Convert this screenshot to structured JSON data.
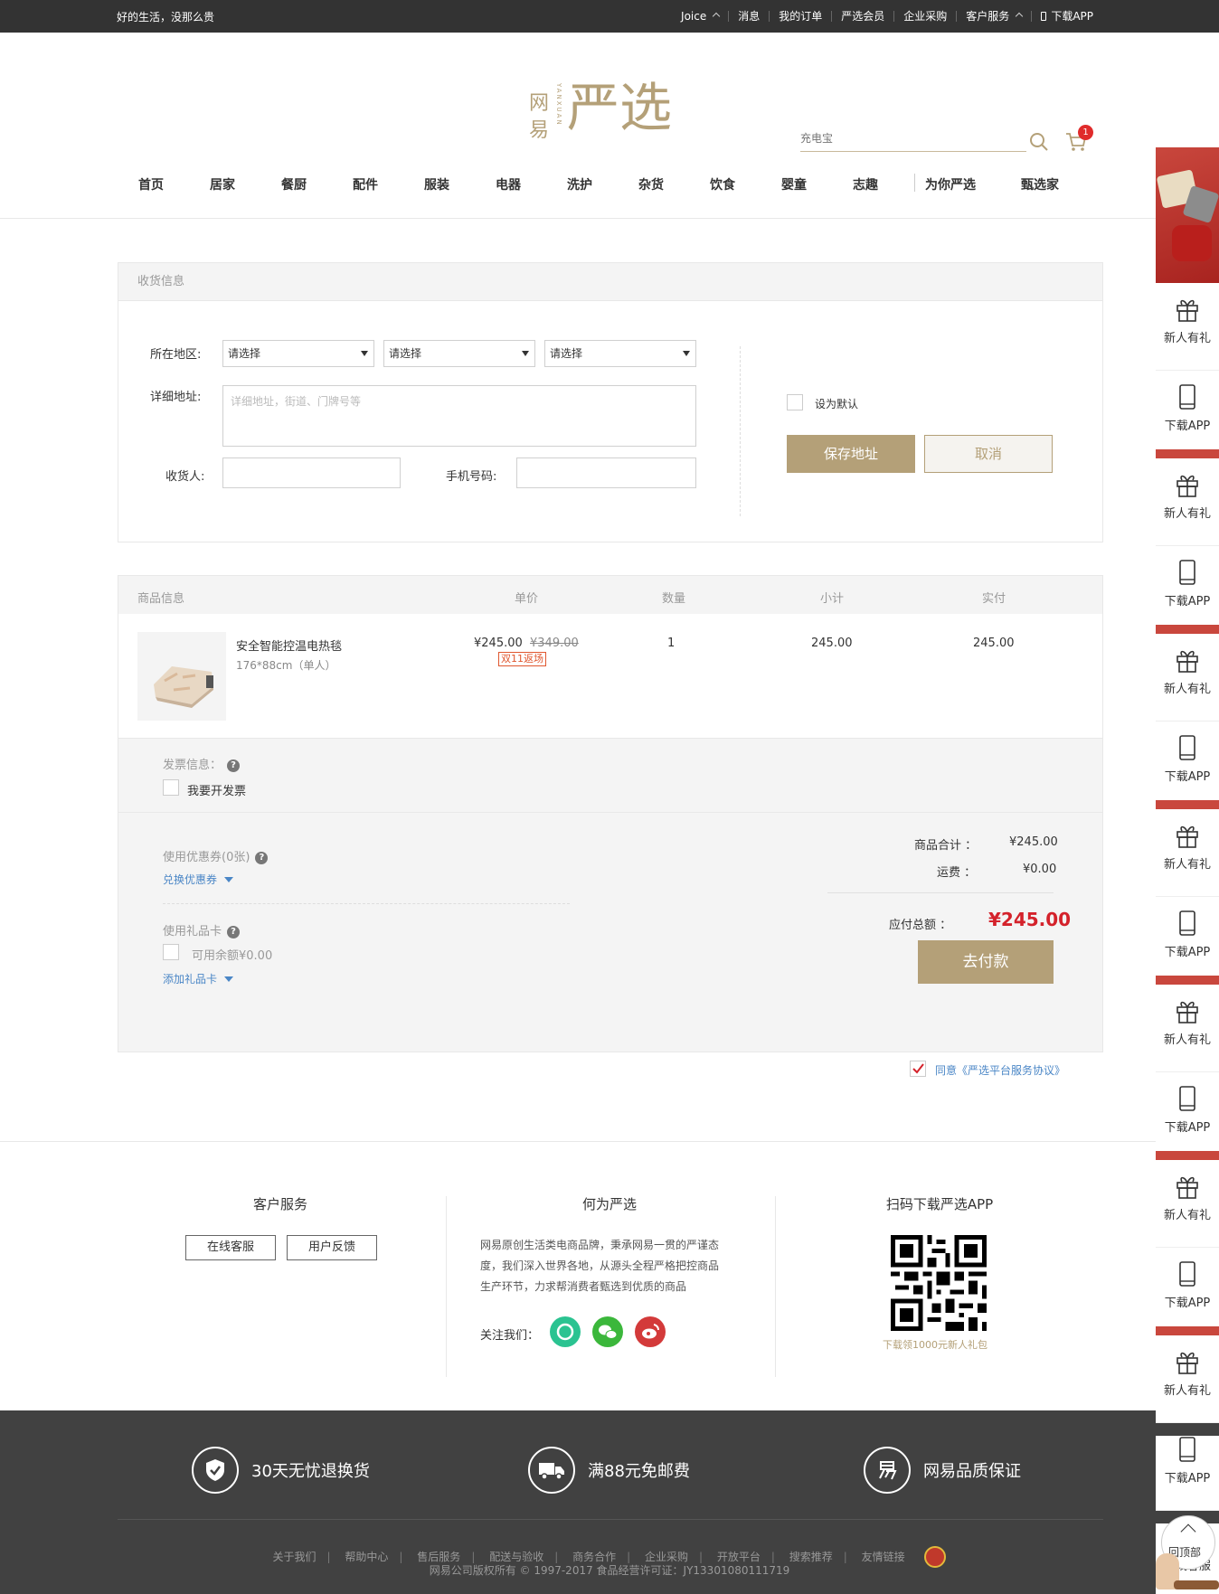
{
  "topbar": {
    "slogan": "好的生活，没那么贵",
    "links": [
      {
        "label": "Joice",
        "chevron": true
      },
      {
        "label": "消息"
      },
      {
        "label": "我的订单"
      },
      {
        "label": "严选会员"
      },
      {
        "label": "企业采购"
      },
      {
        "label": "客户服务",
        "chevron": true
      },
      {
        "label": "下载APP",
        "phone_icon": true
      }
    ]
  },
  "header": {
    "logo_text_small_1": "网",
    "logo_text_small_2": "易",
    "logo_text_vertical": "YANXUAN",
    "logo_text_big": "严选",
    "search_placeholder": "充电宝",
    "cart_count": "1"
  },
  "nav": [
    "首页",
    "居家",
    "餐厨",
    "配件",
    "服装",
    "电器",
    "洗护",
    "杂货",
    "饮食",
    "婴童",
    "志趣",
    "为你严选",
    "甄选家"
  ],
  "address": {
    "section_title": "收货信息",
    "region_label": "所在地区:",
    "region_selects": [
      "请选择",
      "请选择",
      "请选择"
    ],
    "detail_label": "详细地址:",
    "detail_placeholder": "详细地址，街道、门牌号等",
    "receiver_label": "收货人:",
    "phone_label": "手机号码:",
    "default_label": "设为默认",
    "save_button": "保存地址",
    "cancel_button": "取消"
  },
  "goods": {
    "headers": [
      "商品信息",
      "单价",
      "数量",
      "小计",
      "实付"
    ],
    "item": {
      "name": "安全智能控温电热毯",
      "spec": "176*88cm（单人）",
      "price": "¥245.00",
      "original_price": "¥349.00",
      "tag": "双11返场",
      "quantity": "1",
      "subtotal": "245.00",
      "paid": "245.00"
    },
    "invoice_label": "发票信息：",
    "invoice_checkbox": "我要开发票",
    "coupon_label": "使用优惠券(0张)",
    "coupon_link": "兑换优惠券",
    "giftcard_label": "使用礼品卡",
    "giftcard_balance": "可用余额¥0.00",
    "giftcard_link": "添加礼品卡",
    "summary": {
      "goods_total_label": "商品合计 ：",
      "goods_total": "¥245.00",
      "shipping_label": "运费 ：",
      "shipping": "¥0.00",
      "payable_label": "应付总额 ：",
      "payable": "¥245.00",
      "pay_button": "去付款"
    },
    "agree_text": "同意《严选平台服务协议》"
  },
  "footer": {
    "service_title": "客户服务",
    "online_service_button": "在线客服",
    "feedback_button": "用户反馈",
    "about_title": "何为严选",
    "about_text": [
      "网易原创生活类电商品牌，秉承网易一贯的严谨态",
      "度，我们深入世界各地，从源头全程严格把控商品",
      "生产环节，力求帮消费者甄选到优质的商品"
    ],
    "follow_label": "关注我们：",
    "app_title": "扫码下载严选APP",
    "app_caption": "下载领1000元新人礼包",
    "promises": [
      "30天无忧退换货",
      "满88元免邮费",
      "网易品质保证"
    ],
    "links": [
      "关于我们",
      "帮助中心",
      "售后服务",
      "配送与验收",
      "商务合作",
      "企业采购",
      "开放平台",
      "搜索推荐",
      "友情链接"
    ],
    "copyright": "网易公司版权所有 © 1997-2017   食品经营许可证：JY13301080111719"
  },
  "sidebar": {
    "items": [
      "新人有礼",
      "下载APP",
      "新人有礼",
      "下载APP",
      "新人有礼",
      "下载APP",
      "新人有礼",
      "下载APP",
      "新人有礼",
      "下载APP",
      "新人有礼",
      "下载APP",
      "新人有礼",
      "下载APP",
      "在线客服"
    ],
    "back_to_top": "回顶部"
  },
  "colors": {
    "brand_gold": "#b4a078",
    "price_red": "#d4222b",
    "link_blue": "#4a86c6",
    "topbar_bg": "#333333",
    "footer_bg": "#414141"
  }
}
